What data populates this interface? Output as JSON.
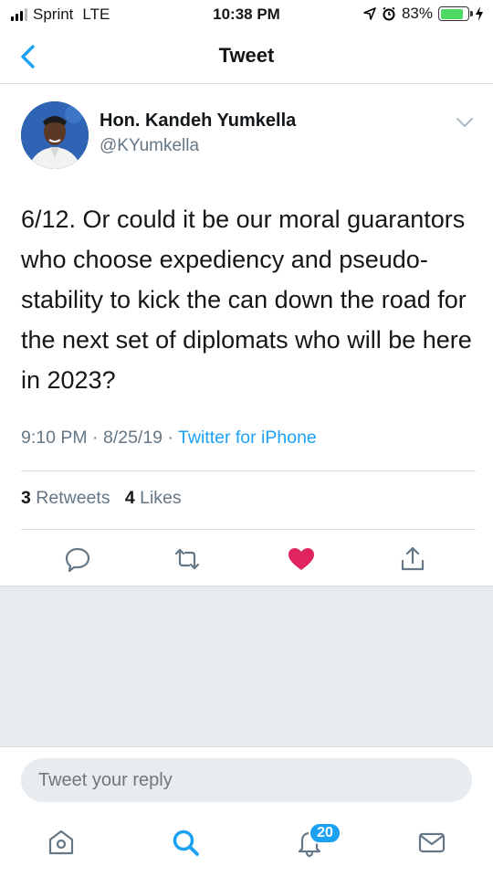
{
  "status_bar": {
    "carrier": "Sprint",
    "network": "LTE",
    "time": "10:38 PM",
    "battery": "83%",
    "battery_level": 0.83
  },
  "nav": {
    "title": "Tweet"
  },
  "tweet": {
    "author_name": "Hon. Kandeh Yumkella",
    "handle": "@KYumkella",
    "text": "6/12. Or could it be our moral guarantors who choose expediency and pseudo-stability to kick the can down the road for the next set of diplomats who will be here in 2023?",
    "time": "9:10 PM",
    "date": "8/25/19",
    "separator": "·",
    "source": "Twitter for iPhone",
    "retweet_count": "3",
    "retweet_label": "Retweets",
    "like_count": "4",
    "like_label": "Likes"
  },
  "reply": {
    "placeholder": "Tweet your reply"
  },
  "tab_bar": {
    "notifications_badge": "20"
  },
  "colors": {
    "accent": "#1da1f2",
    "like": "#e0245e",
    "secondary_text": "#657786",
    "background_gray": "#e6ecf0"
  }
}
